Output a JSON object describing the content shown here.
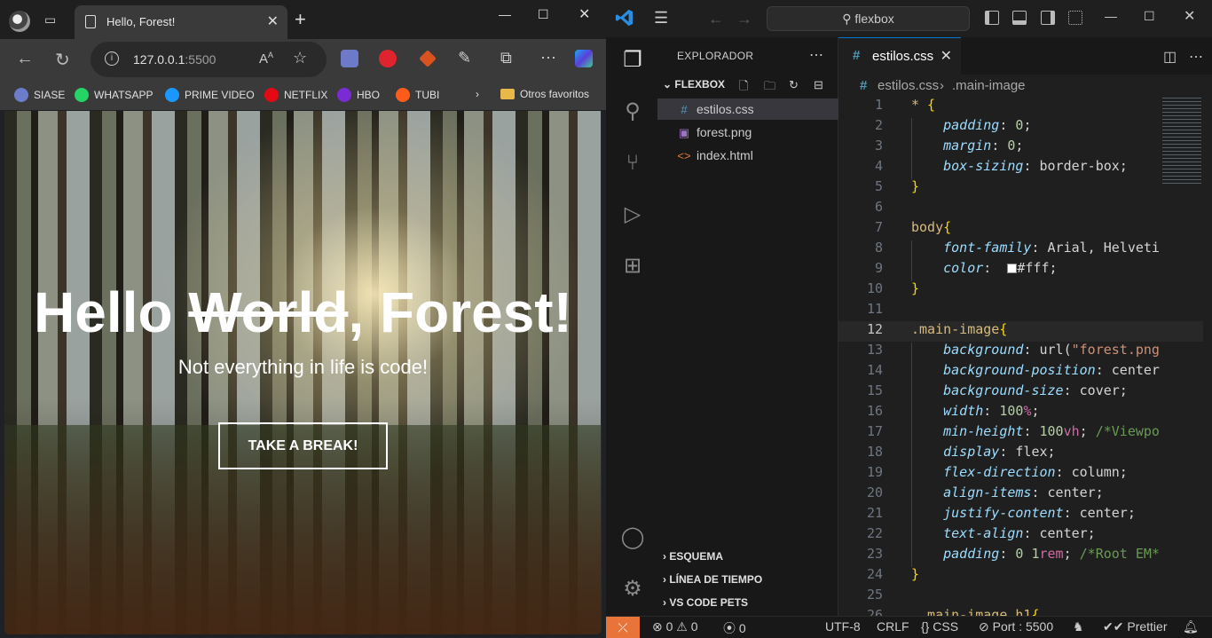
{
  "browser": {
    "tab_title": "Hello, Forest!",
    "url_host": "127.0.0.1",
    "url_port": ":5500",
    "bookmarks": [
      {
        "label": "SIASE",
        "color": "#6b7cc9"
      },
      {
        "label": "WHATSAPP",
        "color": "#25d366"
      },
      {
        "label": "PRIME VIDEO",
        "color": "#1a98ff"
      },
      {
        "label": "NETFLIX",
        "color": "#e50914"
      },
      {
        "label": "HBO",
        "color": "#7b2bd4"
      },
      {
        "label": "TUBI",
        "color": "#ff5b1a"
      }
    ],
    "bookmarks_more": "›",
    "other_favorites": "Otros favoritos",
    "page": {
      "title_part1": "Hello ",
      "title_struck": "World",
      "title_part2": ", Forest!",
      "subtitle": "Not everything in life is code!",
      "button_label": "TAKE A BREAK!"
    }
  },
  "vscode": {
    "search_label": "flexbox",
    "explorer_title": "EXPLORADOR",
    "folder_name": "FLEXBOX",
    "files": [
      {
        "name": "estilos.css",
        "icon": "#",
        "icon_color": "#519aba"
      },
      {
        "name": "forest.png",
        "icon": "▣",
        "icon_color": "#a074c4"
      },
      {
        "name": "index.html",
        "icon": "<>",
        "icon_color": "#e37933"
      }
    ],
    "sections": [
      "ESQUEMA",
      "LÍNEA DE TIEMPO",
      "VS CODE PETS"
    ],
    "open_tab": "estilos.css",
    "breadcrumb_file": "estilos.css",
    "breadcrumb_symbol": ".main-image",
    "current_line": 12,
    "code_lines": [
      {
        "n": "1",
        "t": "* {"
      },
      {
        "n": "2",
        "t": "    padding: 0;"
      },
      {
        "n": "3",
        "t": "    margin: 0;"
      },
      {
        "n": "4",
        "t": "    box-sizing: border-box;"
      },
      {
        "n": "5",
        "t": "}"
      },
      {
        "n": "6",
        "t": ""
      },
      {
        "n": "7",
        "t": "body{"
      },
      {
        "n": "8",
        "t": "    font-family: Arial, Helveti"
      },
      {
        "n": "9",
        "t": "    color:  #fff;"
      },
      {
        "n": "10",
        "t": "}"
      },
      {
        "n": "11",
        "t": ""
      },
      {
        "n": "12",
        "t": ".main-image{"
      },
      {
        "n": "13",
        "t": "    background: url(\"forest.png"
      },
      {
        "n": "14",
        "t": "    background-position: center"
      },
      {
        "n": "15",
        "t": "    background-size: cover;"
      },
      {
        "n": "16",
        "t": "    width: 100%;"
      },
      {
        "n": "17",
        "t": "    min-height: 100vh; /*Viewpo"
      },
      {
        "n": "18",
        "t": "    display: flex;"
      },
      {
        "n": "19",
        "t": "    flex-direction: column;"
      },
      {
        "n": "20",
        "t": "    align-items: center;"
      },
      {
        "n": "21",
        "t": "    justify-content: center;"
      },
      {
        "n": "22",
        "t": "    text-align: center;"
      },
      {
        "n": "23",
        "t": "    padding: 0 1rem; /*Root EM*"
      },
      {
        "n": "24",
        "t": "}"
      },
      {
        "n": "25",
        "t": ""
      },
      {
        "n": "26",
        "t": " .main-image h1{"
      }
    ],
    "status": {
      "errors": "0",
      "warnings": "0",
      "ports": "0",
      "encoding": "UTF-8",
      "eol": "CRLF",
      "language": "CSS",
      "live_server": "Port : 5500",
      "formatter": "Prettier"
    }
  }
}
